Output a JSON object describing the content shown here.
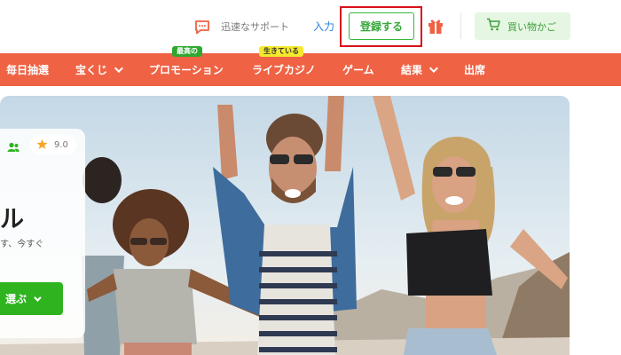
{
  "header": {
    "support_label": "迅速なサポート",
    "login_label": "入力",
    "register_label": "登録する",
    "cart_label": "買い物かご"
  },
  "nav": {
    "items": [
      {
        "label": "毎日抽選"
      },
      {
        "label": "宝くじ"
      },
      {
        "label": "プロモーション",
        "badge": "最高の"
      },
      {
        "label": "ライブカジノ",
        "badge": "生きている"
      },
      {
        "label": "ゲーム"
      },
      {
        "label": "結果"
      },
      {
        "label": "出席"
      }
    ]
  },
  "promo_card": {
    "rating": "9.0",
    "title_fragment": "ル",
    "subtitle_fragment": "す、今すぐ",
    "button_fragment": "選ぶ"
  },
  "colors": {
    "nav_background": "#ef6244",
    "register_green": "#38b73b",
    "highlight_red": "#d8121a",
    "cart_background": "#e5f7e2",
    "card_button_green": "#2fb31f",
    "star_orange": "#f5a623"
  },
  "icons": {
    "support": "chat-bubble-icon",
    "gift": "gift-icon",
    "cart": "shopping-cart-icon",
    "users": "users-icon",
    "rating": "star-icon"
  }
}
